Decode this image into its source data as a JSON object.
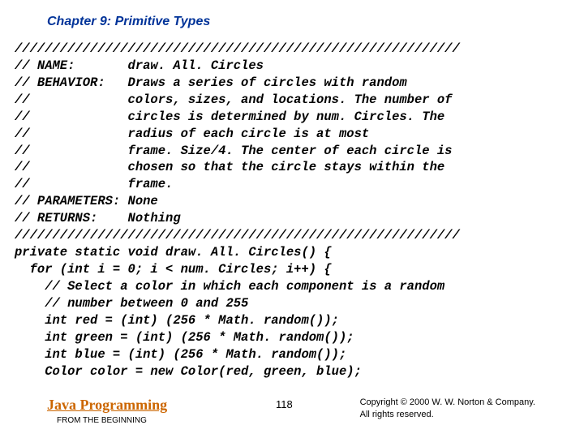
{
  "chapter": "Chapter 9: Primitive Types",
  "code": {
    "l01": "///////////////////////////////////////////////////////////",
    "l02": "// NAME:       draw. All. Circles",
    "l03": "// BEHAVIOR:   Draws a series of circles with random",
    "l04": "//             colors, sizes, and locations. The number of",
    "l05": "//             circles is determined by num. Circles. The",
    "l06": "//             radius of each circle is at most",
    "l07": "//             frame. Size/4. The center of each circle is",
    "l08": "//             chosen so that the circle stays within the",
    "l09": "//             frame.",
    "l10": "// PARAMETERS: None",
    "l11": "// RETURNS:    Nothing",
    "l12": "///////////////////////////////////////////////////////////",
    "l13": "private static void draw. All. Circles() {",
    "l14": "  for (int i = 0; i < num. Circles; i++) {",
    "l15": "    // Select a color in which each component is a random",
    "l16": "    // number between 0 and 255",
    "l17": "    int red = (int) (256 * Math. random());",
    "l18": "    int green = (int) (256 * Math. random());",
    "l19": "    int blue = (int) (256 * Math. random());",
    "l20": "    Color color = new Color(red, green, blue);"
  },
  "footer": {
    "book_title": "Java Programming",
    "book_sub": "FROM THE BEGINNING",
    "page": "118",
    "copyright_l1": "Copyright © 2000 W. W. Norton & Company.",
    "copyright_l2": "All rights reserved."
  }
}
